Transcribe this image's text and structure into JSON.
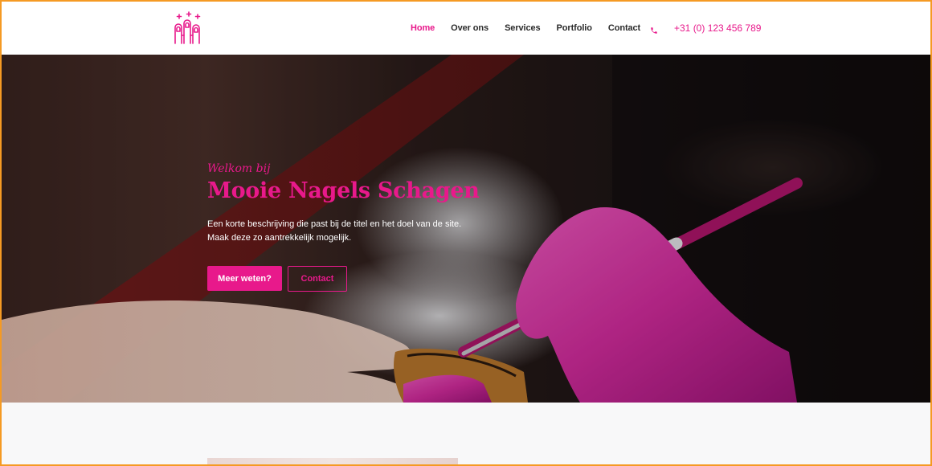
{
  "header": {
    "logo": {
      "icon": "nails-logo-icon",
      "color": "#e8198b"
    },
    "nav": [
      {
        "label": "Home",
        "active": true
      },
      {
        "label": "Over ons",
        "active": false
      },
      {
        "label": "Services",
        "active": false
      },
      {
        "label": "Portfolio",
        "active": false
      },
      {
        "label": "Contact",
        "active": false
      }
    ],
    "phone": {
      "icon": "phone-icon",
      "number": "+31 (0) 123 456 789"
    }
  },
  "hero": {
    "welcome": "Welkom bij",
    "title": "Mooie Nagels Schagen",
    "description": "Een korte beschrijving die past bij de titel en het doel van de site. Maak deze zo aantrekkelijk mogelijk.",
    "primary_button": "Meer weten?",
    "secondary_button": "Contact"
  },
  "colors": {
    "accent": "#e8198b",
    "nav_text": "#2b2b2b",
    "frame_border": "#f59a23"
  }
}
